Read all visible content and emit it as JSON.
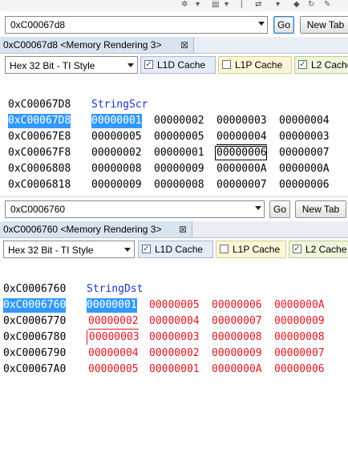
{
  "toolbar": {
    "icons": [
      "tool-icon",
      "dropdown-icon",
      "separator",
      "dropdown-icon",
      "folder-icon",
      "refresh-icon"
    ]
  },
  "pane1": {
    "address": "0xC00067d8",
    "go_label": "Go",
    "newtab_label": "New Tab",
    "tab_label": "0xC00067d8 <Memory Rendering 3>",
    "tab_close": "⊠",
    "format": "Hex 32 Bit - TI Style",
    "cache": [
      "L1D Cache",
      "L1P Cache",
      "L2 Cache"
    ],
    "title": "StringScr",
    "header_addr": "0xC00067D8",
    "rows": [
      {
        "addr": "0xC00067D8",
        "vals": [
          "00000001",
          "00000002",
          "00000003",
          "00000004"
        ]
      },
      {
        "addr": "0xC00067E8",
        "vals": [
          "00000005",
          "00000005",
          "00000004",
          "00000003"
        ]
      },
      {
        "addr": "0xC00067F8",
        "vals": [
          "00000002",
          "00000001",
          "00000006",
          "00000007"
        ]
      },
      {
        "addr": "0xC0006808",
        "vals": [
          "00000008",
          "00000009",
          "0000000A",
          "0000000A"
        ]
      },
      {
        "addr": "0xC0006818",
        "vals": [
          "00000009",
          "00000008",
          "00000007",
          "00000006"
        ]
      }
    ]
  },
  "pane2": {
    "address": "0xC0006760",
    "go_label": "Go",
    "newtab_label": "New Tab",
    "tab_label": "0xC0006760 <Memory Rendering 3>",
    "tab_close": "⊠",
    "format": "Hex 32 Bit - TI Style",
    "cache": [
      "L1D Cache",
      "L1P Cache",
      "L2 Cache"
    ],
    "title": "StringDst",
    "header_addr": "0xC0006760",
    "rows": [
      {
        "addr": "0xC0006760",
        "vals": [
          "00000001",
          "00000005",
          "00000006",
          "0000000A"
        ]
      },
      {
        "addr": "0xC0006770",
        "vals": [
          "00000002",
          "00000004",
          "00000007",
          "00000009"
        ]
      },
      {
        "addr": "0xC0006780",
        "vals": [
          "00000003",
          "00000003",
          "00000008",
          "00000008"
        ]
      },
      {
        "addr": "0xC0006790",
        "vals": [
          "00000004",
          "00000002",
          "00000009",
          "00000007"
        ]
      },
      {
        "addr": "0xC00067A0",
        "vals": [
          "00000005",
          "00000001",
          "0000000A",
          "00000006"
        ]
      }
    ]
  }
}
